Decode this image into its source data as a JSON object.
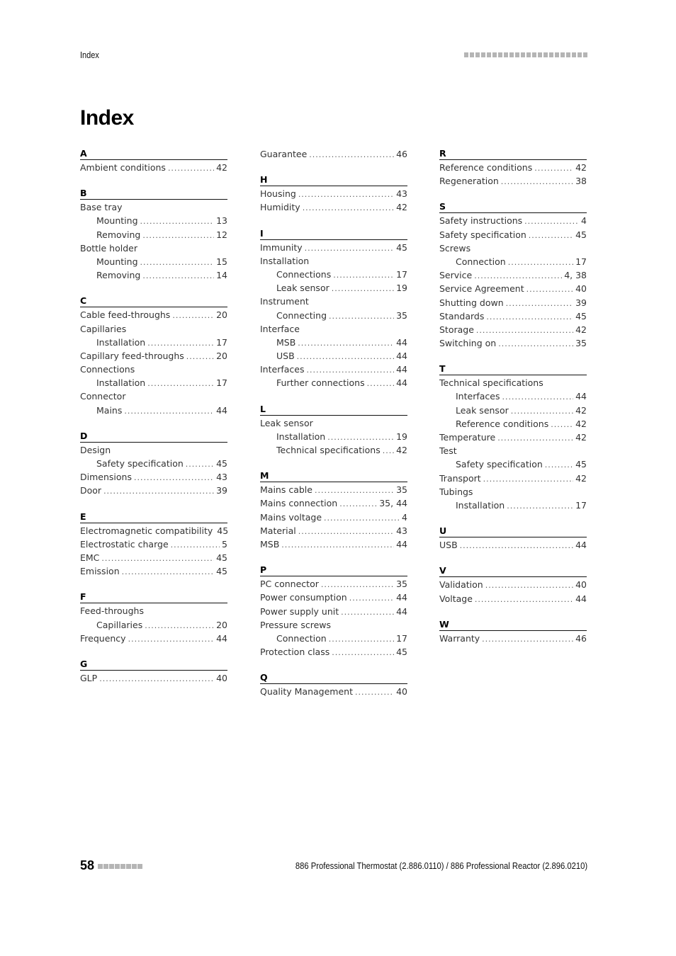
{
  "header": {
    "running_title": "Index",
    "decoration_squares": 22
  },
  "page_title": "Index",
  "columns": [
    {
      "sections": [
        {
          "letter": "A",
          "entries": [
            {
              "term": "Ambient conditions",
              "pages": "42",
              "level": 0
            }
          ]
        },
        {
          "letter": "B",
          "entries": [
            {
              "term": "Base tray",
              "pages": "",
              "level": 0
            },
            {
              "term": "Mounting",
              "pages": "13",
              "level": 1
            },
            {
              "term": "Removing",
              "pages": "12",
              "level": 1
            },
            {
              "term": "Bottle holder",
              "pages": "",
              "level": 0
            },
            {
              "term": "Mounting",
              "pages": "15",
              "level": 1
            },
            {
              "term": "Removing",
              "pages": "14",
              "level": 1
            }
          ]
        },
        {
          "letter": "C",
          "entries": [
            {
              "term": "Cable feed-throughs",
              "pages": "20",
              "level": 0
            },
            {
              "term": "Capillaries",
              "pages": "",
              "level": 0
            },
            {
              "term": "Installation",
              "pages": "17",
              "level": 1
            },
            {
              "term": "Capillary feed-throughs",
              "pages": "20",
              "level": 0
            },
            {
              "term": "Connections",
              "pages": "",
              "level": 0
            },
            {
              "term": "Installation",
              "pages": "17",
              "level": 1
            },
            {
              "term": "Connector",
              "pages": "",
              "level": 0
            },
            {
              "term": "Mains",
              "pages": "44",
              "level": 1
            }
          ]
        },
        {
          "letter": "D",
          "entries": [
            {
              "term": "Design",
              "pages": "",
              "level": 0
            },
            {
              "term": "Safety specification",
              "pages": "45",
              "level": 1
            },
            {
              "term": "Dimensions",
              "pages": "43",
              "level": 0
            },
            {
              "term": "Door",
              "pages": "39",
              "level": 0
            }
          ]
        },
        {
          "letter": "E",
          "entries": [
            {
              "term": "Electromagnetic compatibility",
              "pages": "45",
              "level": 0
            },
            {
              "term": "Electrostatic charge",
              "pages": "5",
              "level": 0
            },
            {
              "term": "EMC",
              "pages": "45",
              "level": 0
            },
            {
              "term": "Emission",
              "pages": "45",
              "level": 0
            }
          ]
        },
        {
          "letter": "F",
          "entries": [
            {
              "term": "Feed-throughs",
              "pages": "",
              "level": 0
            },
            {
              "term": "Capillaries",
              "pages": "20",
              "level": 1
            },
            {
              "term": "Frequency",
              "pages": "44",
              "level": 0
            }
          ]
        },
        {
          "letter": "G",
          "entries": [
            {
              "term": "GLP",
              "pages": "40",
              "level": 0
            }
          ]
        }
      ]
    },
    {
      "sections": [
        {
          "letter": "",
          "entries": [
            {
              "term": "Guarantee",
              "pages": "46",
              "level": 0
            }
          ]
        },
        {
          "letter": "H",
          "entries": [
            {
              "term": "Housing",
              "pages": "43",
              "level": 0
            },
            {
              "term": "Humidity",
              "pages": "42",
              "level": 0
            }
          ]
        },
        {
          "letter": "I",
          "entries": [
            {
              "term": "Immunity",
              "pages": "45",
              "level": 0
            },
            {
              "term": "Installation",
              "pages": "",
              "level": 0
            },
            {
              "term": "Connections",
              "pages": "17",
              "level": 1
            },
            {
              "term": "Leak sensor",
              "pages": "19",
              "level": 1
            },
            {
              "term": "Instrument",
              "pages": "",
              "level": 0
            },
            {
              "term": "Connecting",
              "pages": "35",
              "level": 1
            },
            {
              "term": "Interface",
              "pages": "",
              "level": 0
            },
            {
              "term": "MSB",
              "pages": "44",
              "level": 1
            },
            {
              "term": "USB",
              "pages": "44",
              "level": 1
            },
            {
              "term": "Interfaces",
              "pages": "44",
              "level": 0
            },
            {
              "term": "Further connections",
              "pages": "44",
              "level": 1
            }
          ]
        },
        {
          "letter": "L",
          "entries": [
            {
              "term": "Leak sensor",
              "pages": "",
              "level": 0
            },
            {
              "term": "Installation",
              "pages": "19",
              "level": 1
            },
            {
              "term": "Technical specifications",
              "pages": "42",
              "level": 1
            }
          ]
        },
        {
          "letter": "M",
          "entries": [
            {
              "term": "Mains cable",
              "pages": "35",
              "level": 0
            },
            {
              "term": "Mains connection",
              "pages": "35, 44",
              "level": 0
            },
            {
              "term": "Mains voltage",
              "pages": "4",
              "level": 0
            },
            {
              "term": "Material",
              "pages": "43",
              "level": 0
            },
            {
              "term": "MSB",
              "pages": "44",
              "level": 0
            }
          ]
        },
        {
          "letter": "P",
          "entries": [
            {
              "term": "PC connector",
              "pages": "35",
              "level": 0
            },
            {
              "term": "Power consumption",
              "pages": "44",
              "level": 0
            },
            {
              "term": "Power supply unit",
              "pages": "44",
              "level": 0
            },
            {
              "term": "Pressure screws",
              "pages": "",
              "level": 0
            },
            {
              "term": "Connection",
              "pages": "17",
              "level": 1
            },
            {
              "term": "Protection class",
              "pages": "45",
              "level": 0
            }
          ]
        },
        {
          "letter": "Q",
          "entries": [
            {
              "term": "Quality Management",
              "pages": "40",
              "level": 0
            }
          ]
        }
      ]
    },
    {
      "sections": [
        {
          "letter": "R",
          "entries": [
            {
              "term": "Reference conditions",
              "pages": "42",
              "level": 0
            },
            {
              "term": "Regeneration",
              "pages": "38",
              "level": 0
            }
          ]
        },
        {
          "letter": "S",
          "entries": [
            {
              "term": "Safety instructions",
              "pages": "4",
              "level": 0
            },
            {
              "term": "Safety specification",
              "pages": "45",
              "level": 0
            },
            {
              "term": "Screws",
              "pages": "",
              "level": 0
            },
            {
              "term": "Connection",
              "pages": "17",
              "level": 1
            },
            {
              "term": "Service",
              "pages": "4, 38",
              "level": 0
            },
            {
              "term": "Service Agreement",
              "pages": "40",
              "level": 0
            },
            {
              "term": "Shutting down",
              "pages": "39",
              "level": 0
            },
            {
              "term": "Standards",
              "pages": "45",
              "level": 0
            },
            {
              "term": "Storage",
              "pages": "42",
              "level": 0
            },
            {
              "term": "Switching on",
              "pages": "35",
              "level": 0
            }
          ]
        },
        {
          "letter": "T",
          "entries": [
            {
              "term": "Technical specifications",
              "pages": "",
              "level": 0
            },
            {
              "term": "Interfaces",
              "pages": "44",
              "level": 1
            },
            {
              "term": "Leak sensor",
              "pages": "42",
              "level": 1
            },
            {
              "term": "Reference conditions",
              "pages": "42",
              "level": 1
            },
            {
              "term": "Temperature",
              "pages": "42",
              "level": 0
            },
            {
              "term": "Test",
              "pages": "",
              "level": 0
            },
            {
              "term": "Safety specification",
              "pages": "45",
              "level": 1
            },
            {
              "term": "Transport",
              "pages": "42",
              "level": 0
            },
            {
              "term": "Tubings",
              "pages": "",
              "level": 0
            },
            {
              "term": "Installation",
              "pages": "17",
              "level": 1
            }
          ]
        },
        {
          "letter": "U",
          "entries": [
            {
              "term": "USB",
              "pages": "44",
              "level": 0
            }
          ]
        },
        {
          "letter": "V",
          "entries": [
            {
              "term": "Validation",
              "pages": "40",
              "level": 0
            },
            {
              "term": "Voltage",
              "pages": "44",
              "level": 0
            }
          ]
        },
        {
          "letter": "W",
          "entries": [
            {
              "term": "Warranty",
              "pages": "46",
              "level": 0
            }
          ]
        }
      ]
    }
  ],
  "footer": {
    "page_number": "58",
    "decoration_squares": 8,
    "document_title": "886 Professional Thermostat (2.886.0110) / 886 Professional Reactor (2.896.0210)"
  }
}
